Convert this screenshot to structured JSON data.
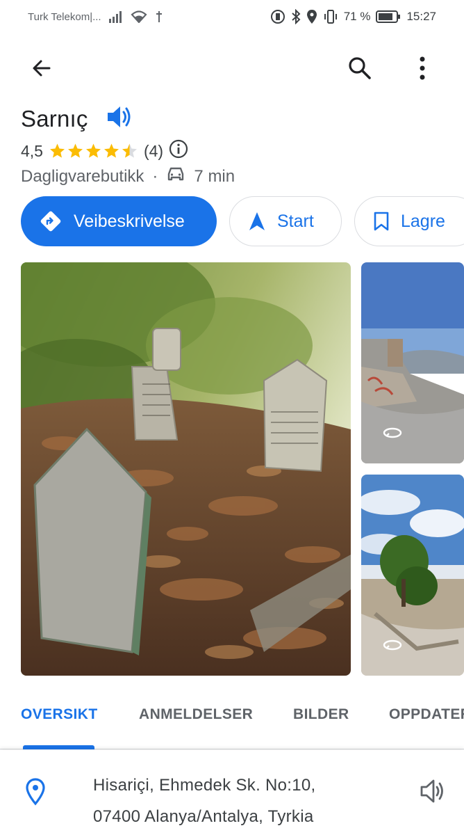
{
  "status_bar": {
    "carrier": "Turk Telekom|...",
    "battery_percent": "71 %",
    "time": "15:27"
  },
  "app_bar": {
    "back_icon": "arrow-left-icon",
    "search_icon": "search-icon",
    "more_icon": "more-vert-icon"
  },
  "place": {
    "name": "Sarnıç",
    "rating": "4,5",
    "rating_value": 4.5,
    "review_count": "(4)",
    "category": "Dagligvarebutikk",
    "separator": "·",
    "travel_time": "7 min"
  },
  "actions": {
    "directions_label": "Veibeskrivelse",
    "start_label": "Start",
    "save_label": "Lagre"
  },
  "tabs": {
    "overview": "OVERSIKT",
    "reviews": "ANMELDELSER",
    "photos": "BILDER",
    "updates": "OPPDATER"
  },
  "address": {
    "line1": "Hisariçi, Ehmedek Sk. No:10,",
    "line2": "07400 Alanya/Antalya, Tyrkia"
  },
  "colors": {
    "accent": "#1a73e8",
    "star": "#fbbc04"
  }
}
